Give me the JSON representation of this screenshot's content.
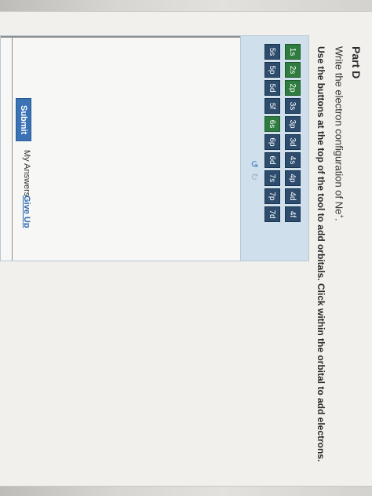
{
  "part": {
    "title": "Part D"
  },
  "question": {
    "prefix": "Write the electron configuration of Ne",
    "superscript": "+",
    "suffix": "."
  },
  "instructions": "Use the buttons at the top of the tool to add orbitals. Click within the orbital to add electrons.",
  "orbitals": {
    "row1": [
      "1s",
      "2s",
      "2p",
      "3s",
      "3p",
      "3d",
      "4s",
      "4p",
      "4d",
      "4f"
    ],
    "row2": [
      "5s",
      "5p",
      "5d",
      "5f",
      "6s",
      "6p",
      "6d",
      "7s",
      "7p",
      "7d"
    ],
    "highlighted": [
      "1s",
      "2s",
      "2p",
      "6s"
    ]
  },
  "tool": {
    "undo_icon": "undo-arrow-icon",
    "redo_icon": "redo-arrow-icon"
  },
  "actions": {
    "submit": "Submit",
    "my_answers": "My Answers",
    "give_up": "Give Up"
  },
  "colors": {
    "orbital_button": "#2e4c6d",
    "orbital_highlight": "#2f7c3f",
    "submit": "#3a72b5",
    "link": "#2d6bb1"
  }
}
